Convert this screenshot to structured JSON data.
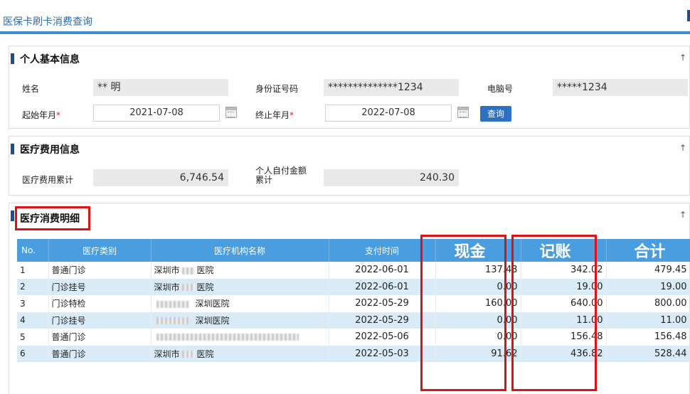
{
  "page": {
    "title": "医保卡刷卡消费查询"
  },
  "personal": {
    "title": "个人基本信息",
    "name_label": "姓名",
    "name_value": "** 明",
    "id_label": "身份证号码",
    "id_value": "**************1234",
    "pc_label": "电脑号",
    "pc_value": "*****1234",
    "start_label": "起始年月",
    "start_value": "2021-07-08",
    "end_label": "终止年月",
    "end_value": "2022-07-08",
    "required_mark": "*",
    "query_label": "查询"
  },
  "medical_cost": {
    "title": "医疗费用信息",
    "total_label": "医疗费用累计",
    "total_value": "6,746.54",
    "self_pay_label_1": "个人自付金额",
    "self_pay_label_2": "累计",
    "self_pay_value": "240.30"
  },
  "detail": {
    "title": "医疗消费明细",
    "columns": [
      "No.",
      "医疗类别",
      "医疗机构名称",
      "支付时间",
      "现金",
      "记账",
      "合计"
    ],
    "rows": [
      {
        "no": "1",
        "type": "普通门诊",
        "org": "深圳市",
        "org_suffix": "医院",
        "date": "2022-06-01",
        "cash": "137.43",
        "acct": "342.02",
        "total": "479.45"
      },
      {
        "no": "2",
        "type": "门诊挂号",
        "org": "深圳市",
        "org_suffix": "医院",
        "date": "2022-06-01",
        "cash": "0.00",
        "acct": "19.00",
        "total": "19.00"
      },
      {
        "no": "3",
        "type": "门诊特检",
        "org": "",
        "org_suffix": "深圳医院",
        "date": "2022-05-29",
        "cash": "160.00",
        "acct": "640.00",
        "total": "800.00"
      },
      {
        "no": "4",
        "type": "门诊挂号",
        "org": "",
        "org_suffix": "深圳医院",
        "date": "2022-05-29",
        "cash": "0.00",
        "acct": "11.00",
        "total": "11.00"
      },
      {
        "no": "5",
        "type": "普通门诊",
        "org": "",
        "org_suffix": "",
        "date": "2022-05-06",
        "cash": "0.00",
        "acct": "156.48",
        "total": "156.48"
      },
      {
        "no": "6",
        "type": "普通门诊",
        "org": "深圳市",
        "org_suffix": "医院",
        "date": "2022-05-03",
        "cash": "91.62",
        "acct": "436.82",
        "total": "528.44"
      }
    ]
  },
  "icons": {
    "collapse": "collapse-arrow-icon",
    "calendar": "calendar-icon"
  }
}
